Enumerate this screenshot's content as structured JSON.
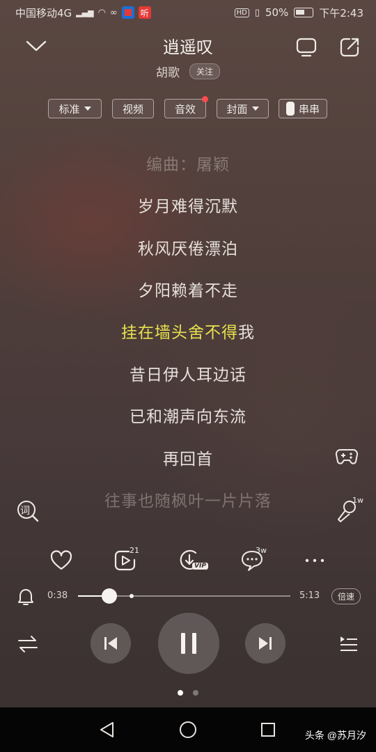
{
  "status_bar": {
    "carrier": "中国移动4G",
    "net_small": "4G",
    "hd_label": "HD",
    "battery": "50%",
    "time": "下午2:43"
  },
  "header": {
    "title": "逍遥叹",
    "artist": "胡歌",
    "follow_label": "关注"
  },
  "chips": {
    "quality": "标准",
    "video": "视频",
    "effects": "音效",
    "cover": "封面",
    "chuanchuan": "串串"
  },
  "lyrics": {
    "lines": [
      "编曲：屠颖",
      "岁月难得沉默",
      "秋风厌倦漂泊",
      "夕阳赖着不走",
      "挂在墙头舍不得我",
      "昔日伊人耳边话",
      "已和潮声向东流",
      "再回首",
      "往事也随枫叶一片片落"
    ],
    "active_sung": "挂在墙头舍不得",
    "active_rest": "我"
  },
  "side": {
    "lyric_icon_label": "词",
    "sing_count": "1w"
  },
  "actions": {
    "share_count": "21",
    "comment_count": "3w",
    "vip_badge": "VIP"
  },
  "player": {
    "current_time": "0:38",
    "total_time": "5:13",
    "speed_label": "倍速",
    "progress_fraction": 0.146,
    "buffered_fraction": 0.254
  },
  "watermark": "头条 @苏月汐",
  "colors": {
    "active_lyric": "#e9e24f",
    "badge_red": "#ff4d4d"
  }
}
